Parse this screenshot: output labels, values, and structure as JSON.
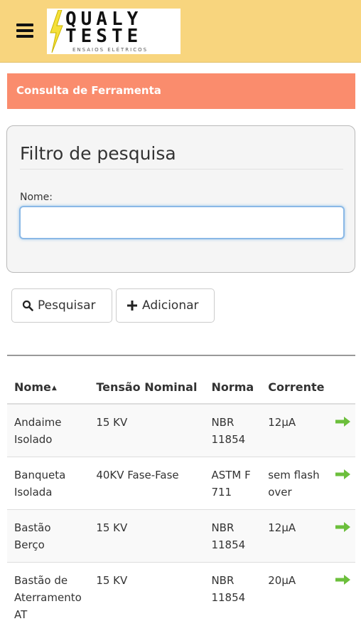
{
  "header": {
    "logo_line1": "QUALY",
    "logo_line2": "TESTE",
    "logo_tagline": "ENSAIOS ELÉTRICOS",
    "menu_icon": "hamburger-menu-icon",
    "background_color": "#f8d57e"
  },
  "page": {
    "title": "Consulta de Ferramenta",
    "title_bg_color": "#fa8c6d"
  },
  "filter": {
    "title": "Filtro de pesquisa",
    "name_label": "Nome:",
    "name_value": "",
    "name_placeholder": ""
  },
  "buttons": {
    "search_label": "Pesquisar",
    "search_icon": "search-icon",
    "add_label": "Adicionar",
    "add_icon": "plus-icon"
  },
  "table": {
    "columns": [
      "Nome",
      "Tensão Nominal",
      "Norma",
      "Corrente"
    ],
    "sort_column": "Nome",
    "sort_direction": "ascending",
    "row_action_icon": "arrow-right-icon",
    "rows": [
      {
        "nome": "Andaime Isolado",
        "tensao": "15 KV",
        "norma": "NBR 11854",
        "corrente": "12µA"
      },
      {
        "nome": "Banqueta Isolada",
        "tensao": "40KV Fase-Fase",
        "norma": "ASTM F 711",
        "corrente": "sem flash over"
      },
      {
        "nome": "Bastão Berço",
        "tensao": "15 KV",
        "norma": "NBR 11854",
        "corrente": "12µA"
      },
      {
        "nome": "Bastão de Aterramento AT",
        "tensao": "15 KV",
        "norma": "NBR 11854",
        "corrente": "20µA"
      }
    ]
  }
}
